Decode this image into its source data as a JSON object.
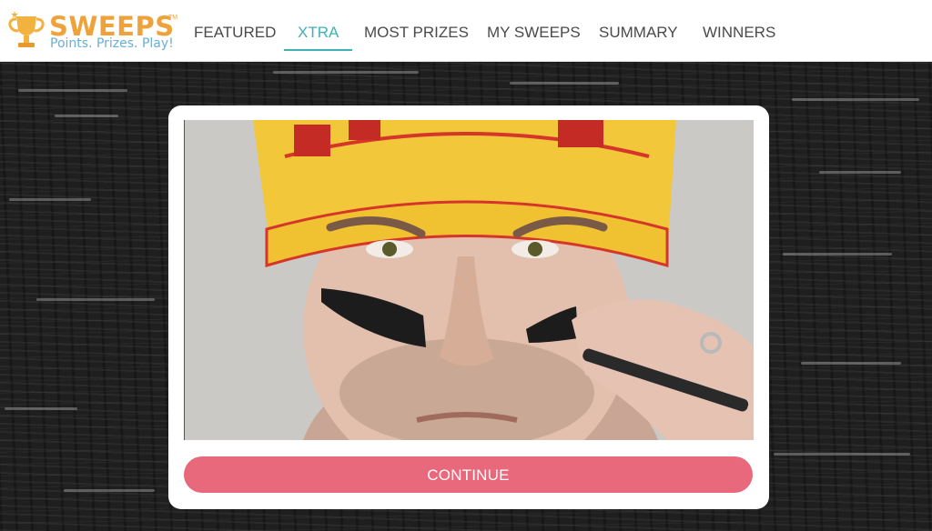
{
  "logo": {
    "brand": "SWEEPS",
    "trademark": "TM",
    "tagline": "Points. Prizes. Play!"
  },
  "nav": {
    "items": [
      {
        "label": "FEATURED",
        "active": false
      },
      {
        "label": "XTRA",
        "active": true
      },
      {
        "label": "MOST PRIZES",
        "active": false
      },
      {
        "label": "MY SWEEPS",
        "active": false
      },
      {
        "label": "SUMMARY",
        "active": false
      },
      {
        "label": "WINNERS",
        "active": false
      }
    ]
  },
  "video": {
    "subject": "man in yellow beanie applying eye black"
  },
  "actions": {
    "continue_label": "CONTINUE"
  },
  "colors": {
    "brand_orange": "#f0a23a",
    "tagline_blue": "#6aaed4",
    "nav_active": "#3fb1b5",
    "continue_button": "#e8687c"
  }
}
